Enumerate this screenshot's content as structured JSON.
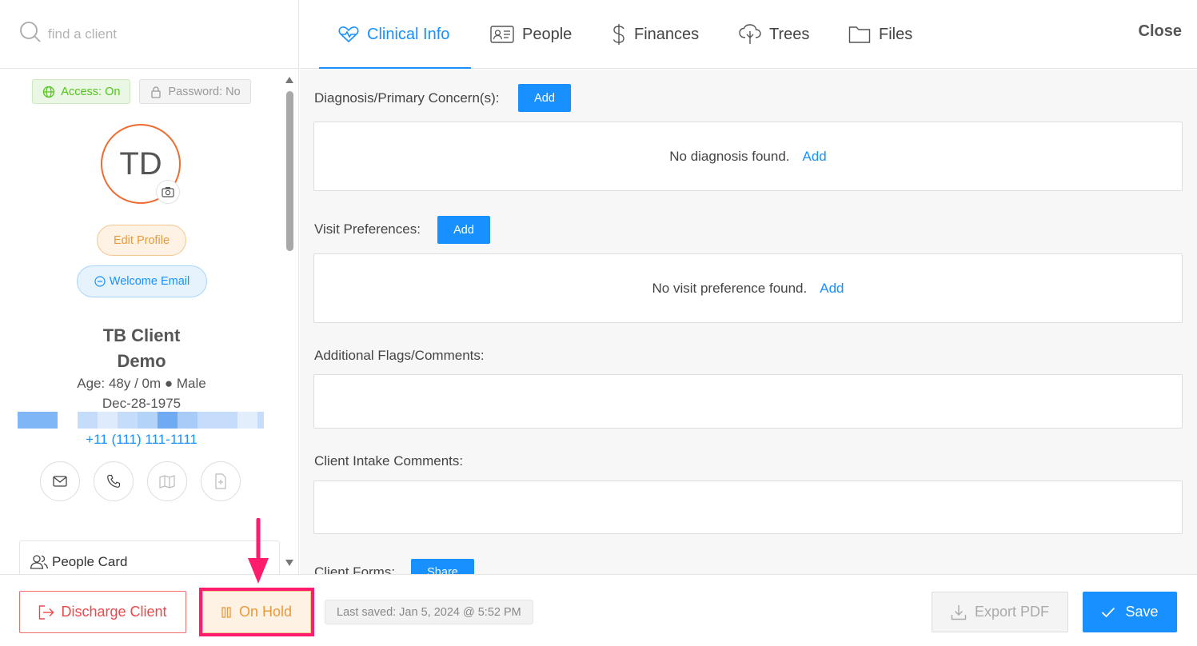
{
  "search": {
    "placeholder": "find a client"
  },
  "badges": {
    "access": "Access: On",
    "password": "Password: No"
  },
  "profile": {
    "initials": "TD",
    "edit_label": "Edit Profile",
    "welcome_label": "Welcome Email",
    "name_line1": "TB Client",
    "name_line2": "Demo",
    "age_sex": "Age: 48y / 0m ● Male",
    "dob": "Dec-28-1975",
    "phone": "+11 (111) 111-1111"
  },
  "people_card": {
    "label": "People Card"
  },
  "tabs": [
    {
      "label": "Clinical Info",
      "icon": "heartbeat-icon",
      "active": true
    },
    {
      "label": "People",
      "icon": "id-card-icon"
    },
    {
      "label": "Finances",
      "icon": "dollar-icon"
    },
    {
      "label": "Trees",
      "icon": "tree-icon"
    },
    {
      "label": "Files",
      "icon": "folder-icon"
    }
  ],
  "close_label": "Close",
  "sections": {
    "diagnosis": {
      "label": "Diagnosis/Primary Concern(s):",
      "add": "Add",
      "empty": "No diagnosis found.",
      "empty_link": "Add"
    },
    "visit": {
      "label": "Visit Preferences:",
      "add": "Add",
      "empty": "No visit preference found.",
      "empty_link": "Add"
    },
    "flags": {
      "label": "Additional Flags/Comments:"
    },
    "intake": {
      "label": "Client Intake Comments:"
    },
    "forms": {
      "label": "Client Forms:",
      "share": "Share"
    }
  },
  "bottom": {
    "discharge": "Discharge Client",
    "on_hold": "On Hold",
    "last_saved": "Last saved: Jan 5, 2024 @ 5:52 PM",
    "export": "Export PDF",
    "save": "Save"
  },
  "colors": {
    "accent": "#1890ff",
    "highlight": "#ff1c6c",
    "warning": "#e89a3c",
    "danger": "#f0464a"
  }
}
